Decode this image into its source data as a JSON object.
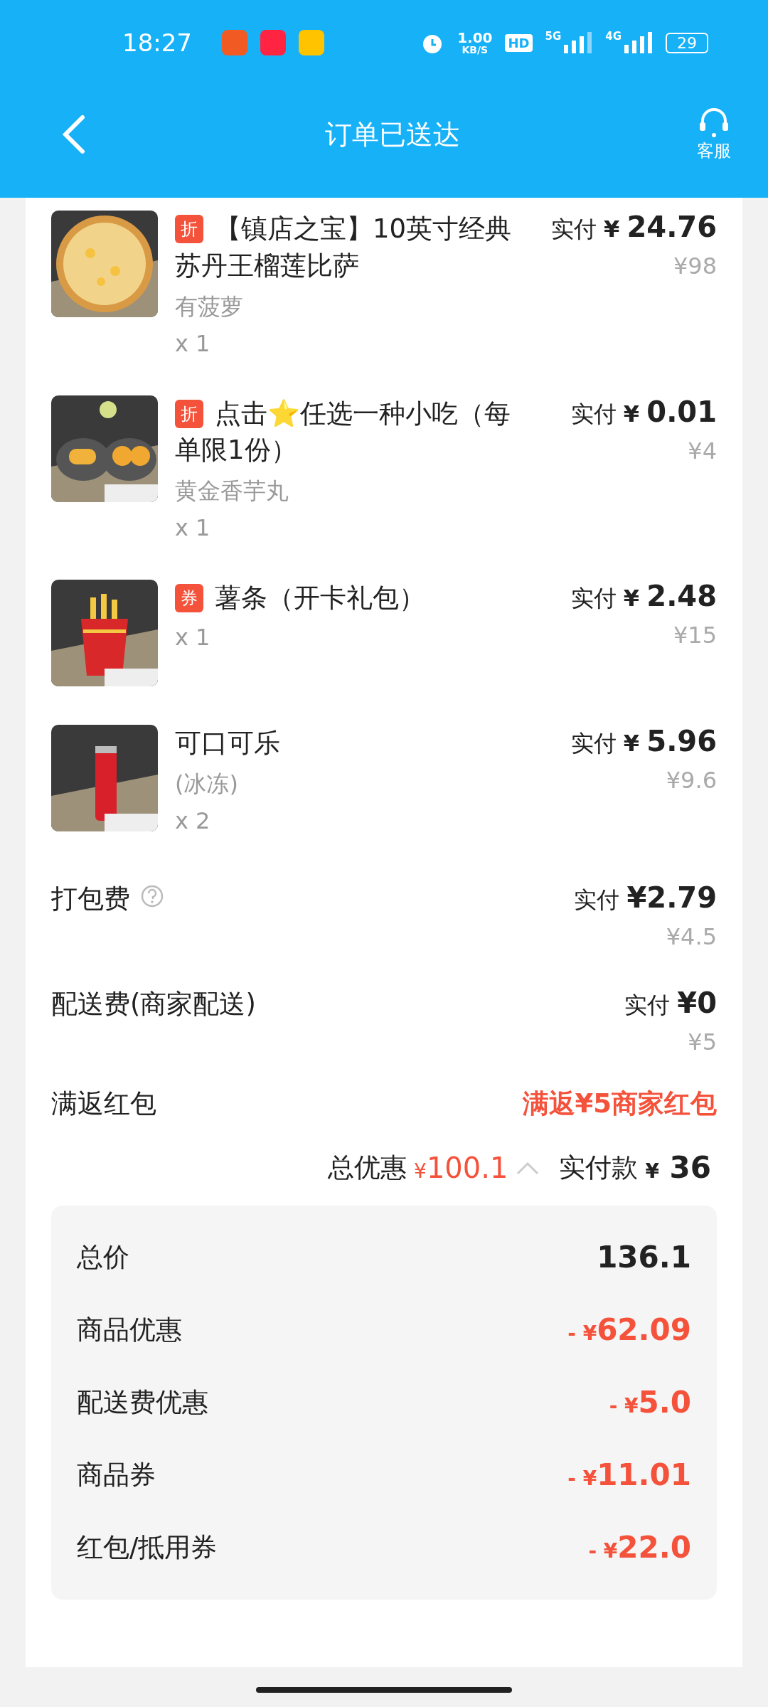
{
  "status_bar": {
    "time": "18:27",
    "speed": "1.00",
    "speed_unit": "KB/S",
    "hd": "HD",
    "net1": "5G",
    "net2": "4G",
    "battery": "29"
  },
  "header": {
    "title": "订单已送达",
    "service": "客服"
  },
  "items": [
    {
      "badge": "折",
      "name": "【镇店之宝】10英寸经典苏丹王榴莲比萨",
      "spec": "有菠萝",
      "qty": "x 1",
      "paid_label": "实付",
      "currency": "¥",
      "paid": "24.76",
      "original": "¥98"
    },
    {
      "badge": "折",
      "name": "点击⭐任选一种小吃（每单限1份）",
      "spec": "黄金香芋丸",
      "qty": "x 1",
      "paid_label": "实付",
      "currency": "¥",
      "paid": "0.01",
      "original": "¥4"
    },
    {
      "badge": "券",
      "name": "薯条（开卡礼包）",
      "qty": "x 1",
      "paid_label": "实付",
      "currency": "¥",
      "paid": "2.48",
      "original": "¥15"
    },
    {
      "name": "可口可乐",
      "spec": "(冰冻)",
      "qty": "x 2",
      "paid_label": "实付",
      "currency": "¥",
      "paid": "5.96",
      "original": "¥9.6"
    }
  ],
  "fees": [
    {
      "label": "打包费",
      "help": true,
      "paid_label": "实付",
      "paid": "¥2.79",
      "original": "¥4.5"
    },
    {
      "label": "配送费(商家配送)",
      "help": false,
      "paid_label": "实付",
      "paid": "¥0",
      "original": "¥5"
    }
  ],
  "rebate": {
    "label": "满返红包",
    "value": "满返¥5商家红包"
  },
  "summary": {
    "discount_label": "总优惠",
    "discount_currency": "¥",
    "discount": "100.1",
    "expanded": true,
    "pay_label": "实付款",
    "pay_currency": "¥",
    "pay": "36"
  },
  "breakdown": [
    {
      "kind": "total",
      "label": "总价",
      "amount": "136.1"
    },
    {
      "kind": "discount",
      "label": "商品优惠",
      "prefix": "- ¥",
      "amount": "62.09"
    },
    {
      "kind": "discount",
      "label": "配送费优惠",
      "prefix": "- ¥",
      "amount": "5.0"
    },
    {
      "kind": "discount",
      "label": "商品券",
      "prefix": "- ¥",
      "amount": "11.01"
    },
    {
      "kind": "discount",
      "label": "红包/抵用券",
      "prefix": "- ¥",
      "amount": "22.0"
    }
  ]
}
